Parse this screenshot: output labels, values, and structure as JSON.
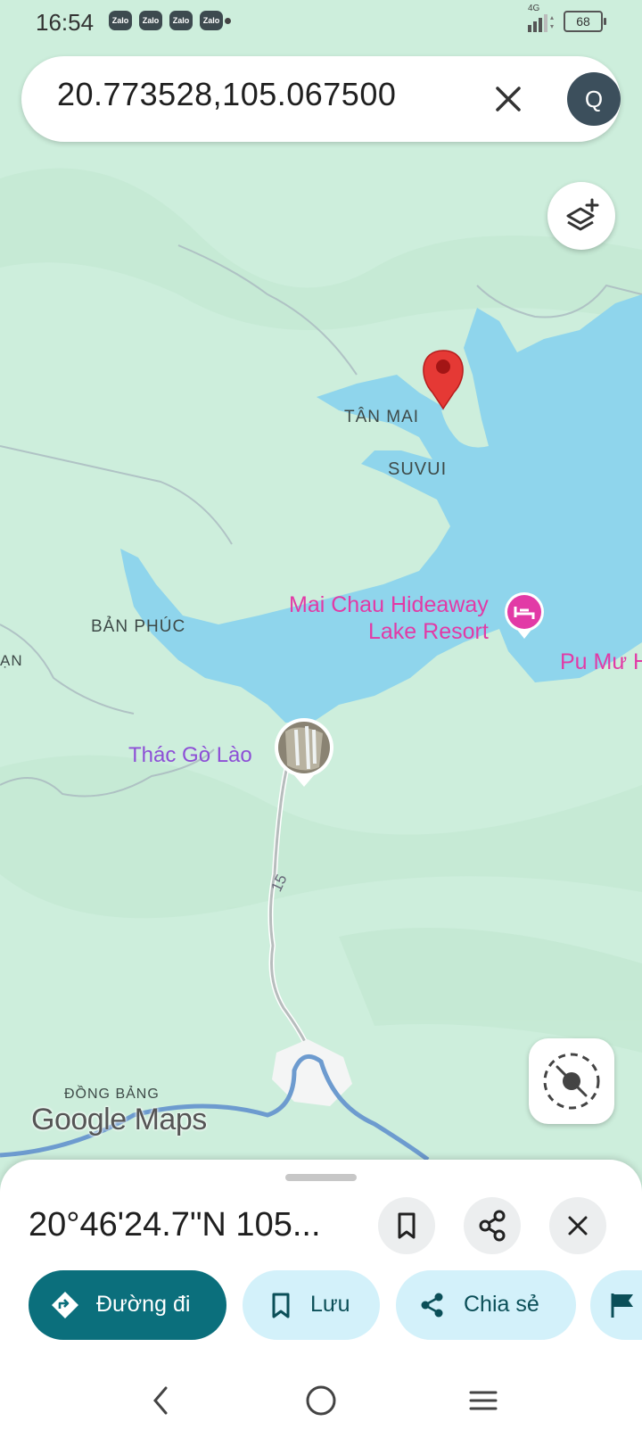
{
  "status_bar": {
    "time": "16:54",
    "zalo_icons": [
      "Zalo",
      "Zalo",
      "Zalo",
      "Zalo"
    ],
    "network": "4G",
    "battery": "68"
  },
  "search": {
    "query": "20.773528,105.067500",
    "avatar_letter": "Q"
  },
  "map": {
    "labels": {
      "tan_mai": "TÂN MAI",
      "suvui": "SUVUI",
      "ban_phuc": "BẢN PHÚC",
      "edge_left": "ẠN",
      "resort_line1": "Mai Chau Hideaway",
      "resort_line2": "Lake Resort",
      "pu_mu": "Pu Mư H",
      "waterfall": "Thác Gò Lào",
      "road_number": "15",
      "dong_bang": "ĐỒNG BẢNG"
    },
    "attribution": "Google Maps",
    "colors": {
      "land": "#cdeedc",
      "water": "#8fd5ec",
      "pin": "#e53935",
      "poi_pink": "#e23aa6",
      "poi_purple": "#8d4fd6"
    }
  },
  "sheet": {
    "coordinates": "20°46'24.7\"N 105...",
    "actions": {
      "directions": "Đường đi",
      "save": "Lưu",
      "share": "Chia sẻ"
    },
    "accent_color": "#0b6f7c"
  }
}
